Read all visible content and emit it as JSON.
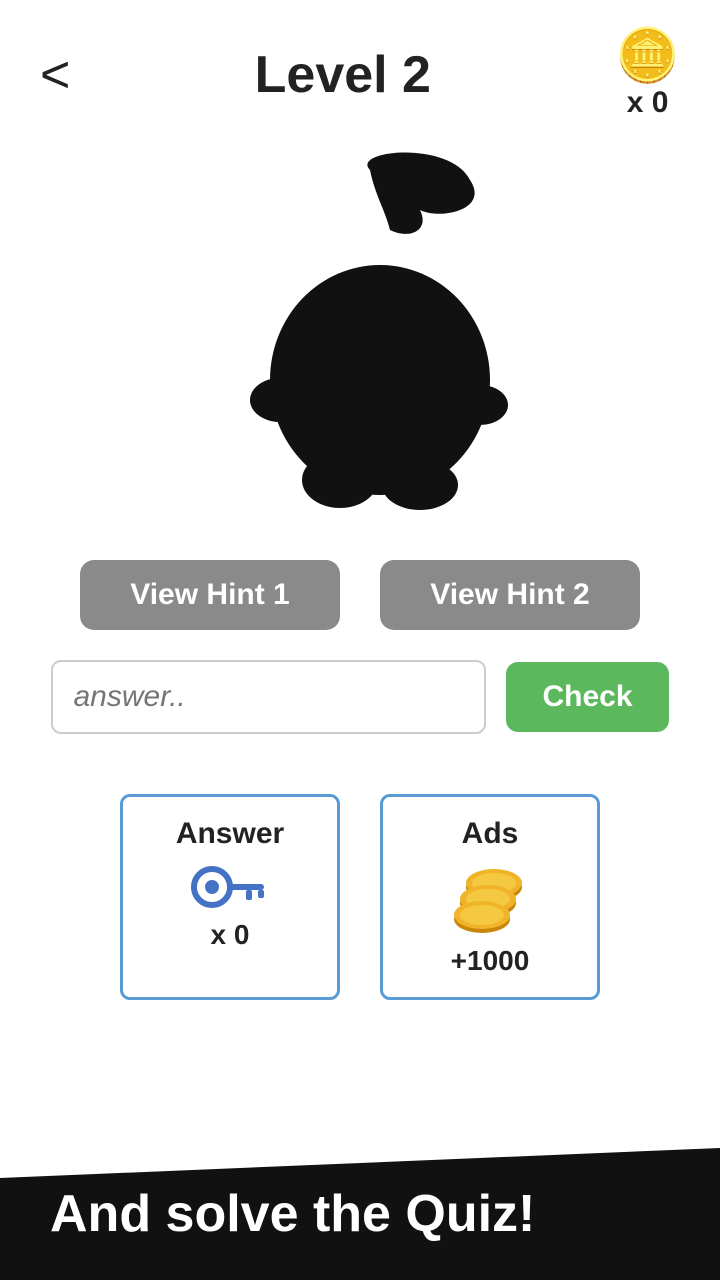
{
  "header": {
    "back_label": "<",
    "title": "Level 2",
    "coins_icon": "🪙",
    "coins_count": "x 0"
  },
  "hint_buttons": {
    "hint1_label": "View Hint 1",
    "hint2_label": "View Hint 2"
  },
  "answer_input": {
    "placeholder": "answer.."
  },
  "check_button": {
    "label": "Check"
  },
  "powerup_cards": [
    {
      "label": "Answer",
      "icon": "key",
      "value": "x 0"
    },
    {
      "label": "Ads",
      "icon": "coins",
      "value": "+1000"
    }
  ],
  "bottom_banner": {
    "text": "And solve the Quiz!"
  }
}
